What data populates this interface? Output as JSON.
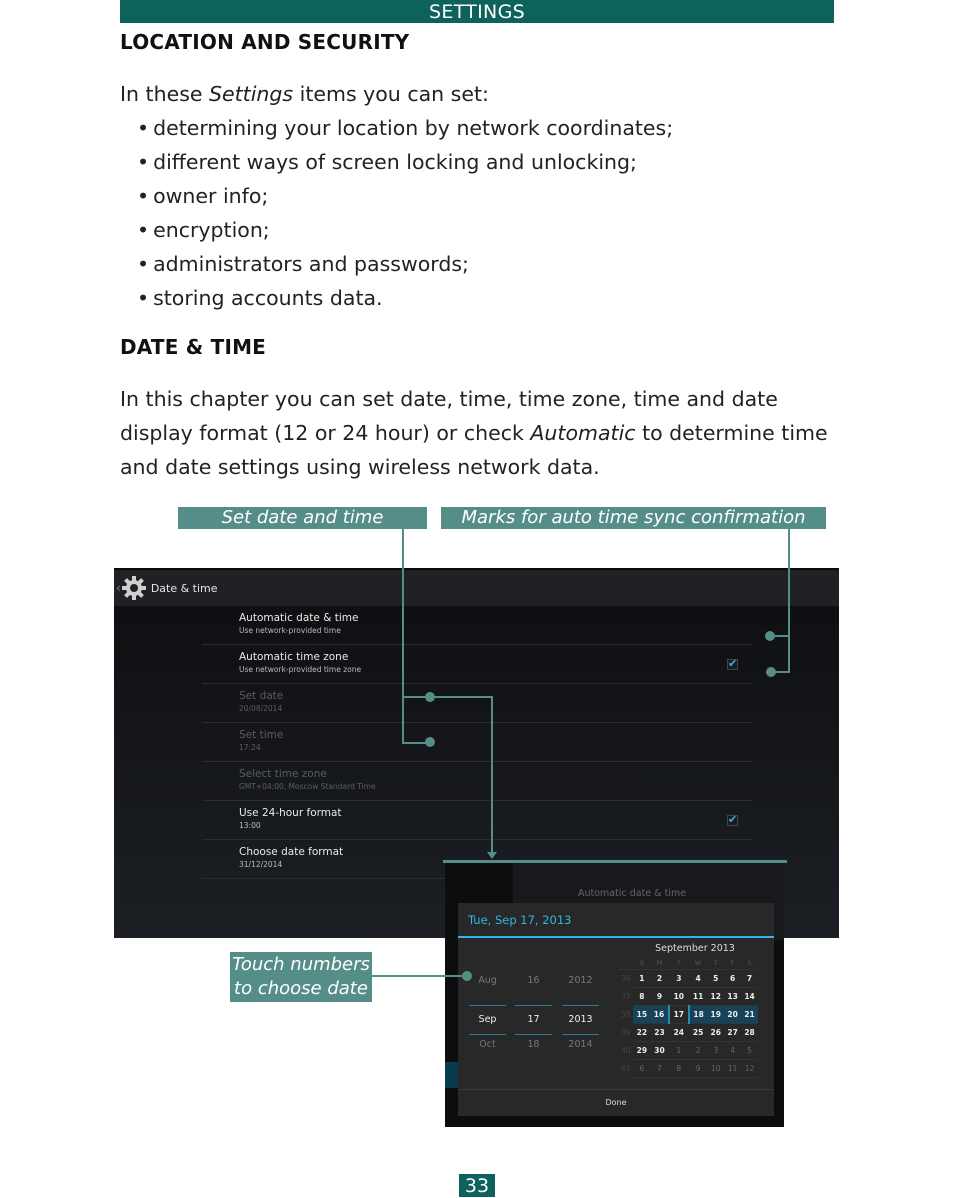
{
  "header": {
    "section": "SETTINGS"
  },
  "location_security": {
    "heading": "LOCATION AND SECURITY",
    "intro_before": "In these ",
    "intro_italic": "Settings",
    "intro_after": " items you can set:",
    "bullets": [
      "determining your location by network coordinates;",
      "different ways of screen locking and unlocking;",
      "owner info;",
      "encryption;",
      "administrators and passwords;",
      "storing accounts data."
    ]
  },
  "date_time": {
    "heading": "DATE & TIME",
    "para_before": "In this chapter you can set date, time, time zone, time and date display format (12 or 24 hour) or check ",
    "para_italic": "Automatic",
    "para_after": " to determine time and date settings using wireless network data."
  },
  "callouts": {
    "set_date_time": "Set date and time",
    "auto_sync": "Marks for auto time sync confirmation",
    "touch_numbers_1": "Touch numbers",
    "touch_numbers_2": "to choose date"
  },
  "screen": {
    "title": "Date & time",
    "rows": [
      {
        "title": "Automatic date & time",
        "summary": "Use network-provided time",
        "checked": false,
        "disabled": false
      },
      {
        "title": "Automatic time zone",
        "summary": "Use network-provided time zone",
        "checked": true,
        "disabled": false
      },
      {
        "title": "Set date",
        "summary": "20/08/2014",
        "disabled": true
      },
      {
        "title": "Set time",
        "summary": "17:24",
        "disabled": true
      },
      {
        "title": "Select time zone",
        "summary": "GMT+04:00, Moscow Standard Time",
        "disabled": true
      },
      {
        "title": "Use 24-hour format",
        "summary": "13:00",
        "checked": true,
        "disabled": false
      },
      {
        "title": "Choose date format",
        "summary": "31/12/2014",
        "disabled": false
      }
    ]
  },
  "dialog": {
    "background_label": "Automatic date & time",
    "date_title": "Tue, Sep 17, 2013",
    "pickers": {
      "month": [
        "Aug",
        "Sep",
        "Oct"
      ],
      "day": [
        "16",
        "17",
        "18"
      ],
      "year": [
        "2012",
        "2013",
        "2014"
      ]
    },
    "calendar": {
      "month_label": "September 2013",
      "weekdays": [
        "S",
        "M",
        "T",
        "W",
        "T",
        "F",
        "S"
      ],
      "weeks": [
        {
          "wk": "36",
          "days": [
            "1",
            "2",
            "3",
            "4",
            "5",
            "6",
            "7"
          ]
        },
        {
          "wk": "37",
          "days": [
            "8",
            "9",
            "10",
            "11",
            "12",
            "13",
            "14"
          ]
        },
        {
          "wk": "38",
          "days": [
            "15",
            "16",
            "17",
            "18",
            "19",
            "20",
            "21"
          ]
        },
        {
          "wk": "39",
          "days": [
            "22",
            "23",
            "24",
            "25",
            "26",
            "27",
            "28"
          ]
        },
        {
          "wk": "40",
          "days": [
            "29",
            "30",
            "1",
            "2",
            "3",
            "4",
            "5"
          ]
        },
        {
          "wk": "41",
          "days": [
            "6",
            "7",
            "8",
            "9",
            "10",
            "11",
            "12"
          ]
        }
      ],
      "selected": "17"
    },
    "done_label": "Done"
  },
  "page_number": "33",
  "colors": {
    "brand": "#0e625c",
    "callout": "#558e89",
    "accent": "#33b5e5"
  }
}
